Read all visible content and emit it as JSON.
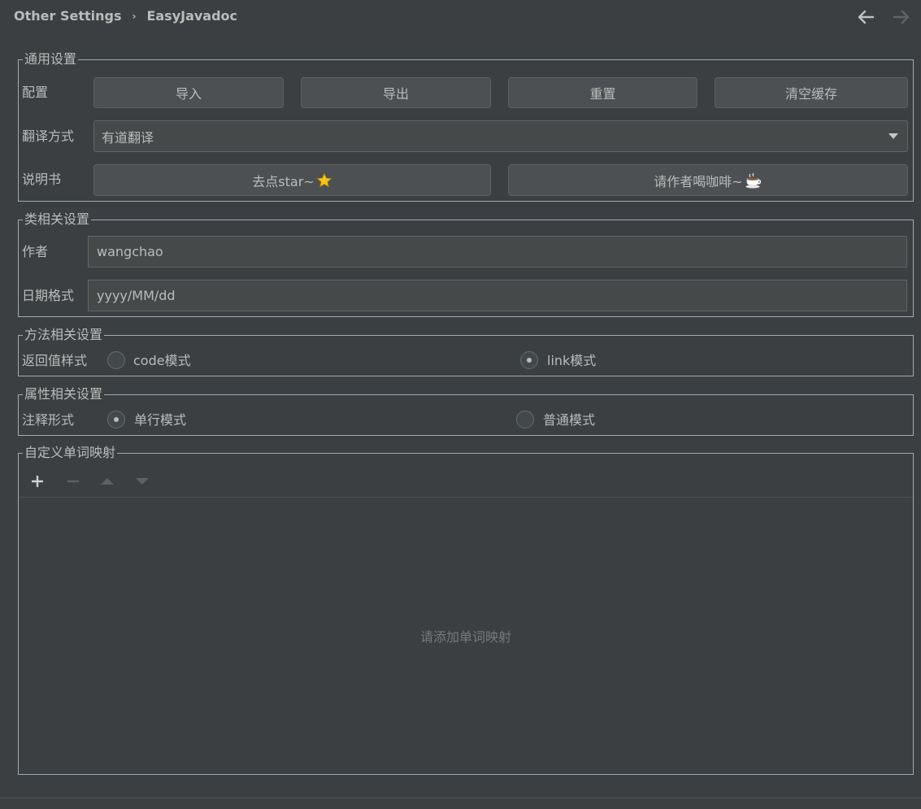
{
  "breadcrumb": {
    "parent": "Other Settings",
    "separator": "›",
    "current": "EasyJavadoc"
  },
  "general": {
    "title": "通用设置",
    "config_label": "配置",
    "import_label": "导入",
    "export_label": "导出",
    "reset_label": "重置",
    "clear_cache_label": "清空缓存",
    "translate_label": "翻译方式",
    "translate_value": "有道翻译",
    "manual_label": "说明书",
    "star_label": "去点star~",
    "coffee_label": "请作者喝咖啡~"
  },
  "class_settings": {
    "title": "类相关设置",
    "author_label": "作者",
    "author_value": "wangchao",
    "date_label": "日期格式",
    "date_value": "yyyy/MM/dd"
  },
  "method_settings": {
    "title": "方法相关设置",
    "return_label": "返回值样式",
    "code_mode": "code模式",
    "link_mode": "link模式",
    "selected": "link"
  },
  "field_settings": {
    "title": "属性相关设置",
    "comment_label": "注释形式",
    "single_mode": "单行模式",
    "normal_mode": "普通模式",
    "selected": "single"
  },
  "word_map": {
    "title": "自定义单词映射",
    "empty_text": "请添加单词映射"
  },
  "colors": {
    "background": "#3c3f41",
    "text": "#bbbbbb",
    "border": "#a0aab3",
    "star": "#f5c518"
  }
}
